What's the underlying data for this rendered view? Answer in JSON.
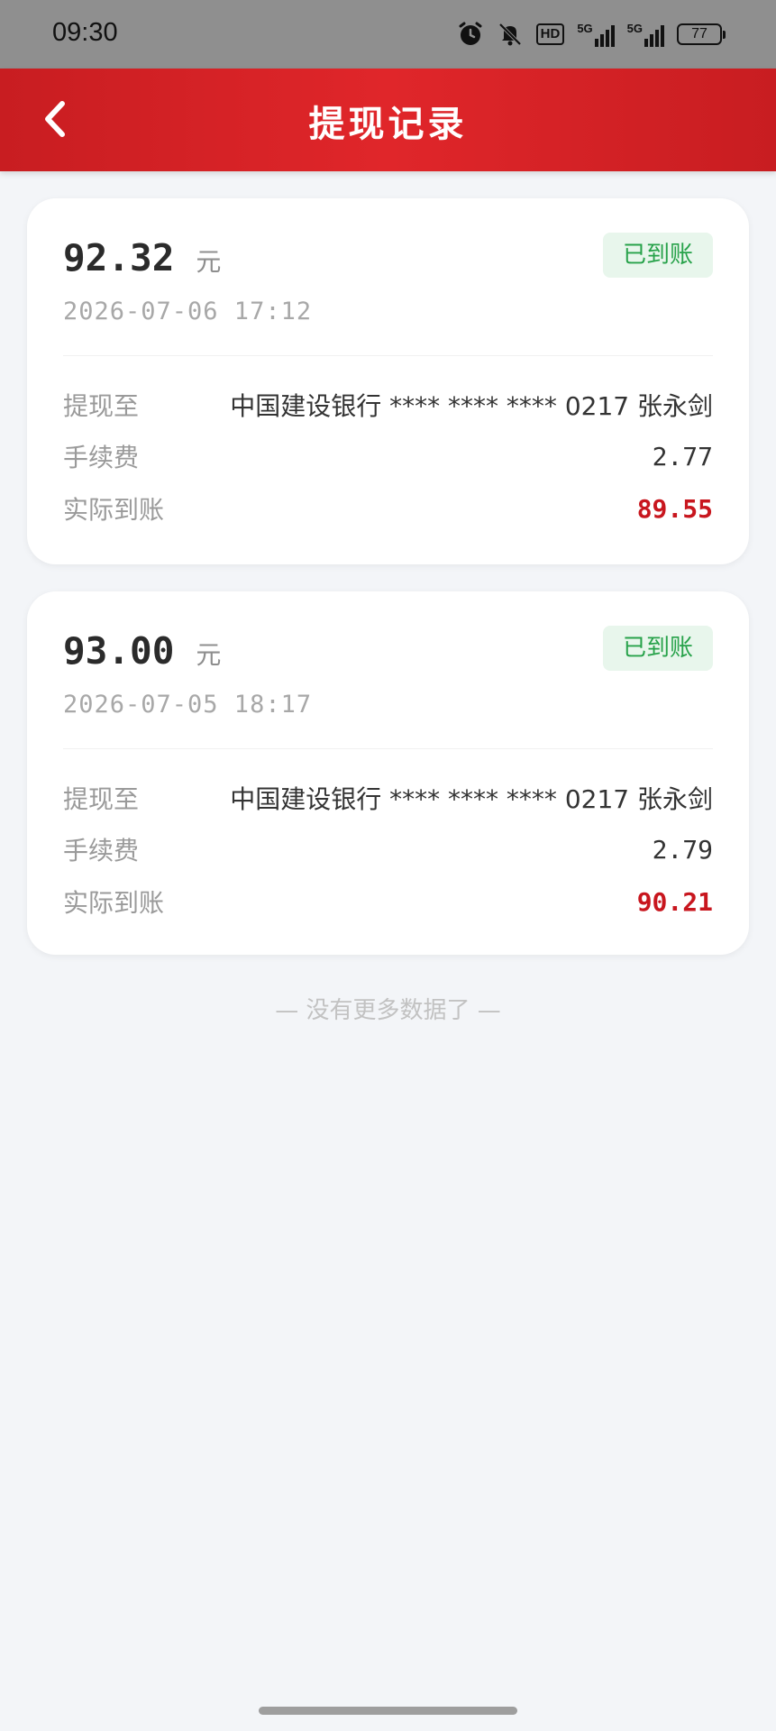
{
  "status_bar": {
    "time": "09:30",
    "hd_label": "HD",
    "network_1": "5G",
    "network_2": "5G",
    "battery": "77"
  },
  "header": {
    "title": "提现记录",
    "back_icon": "chevron-left-icon"
  },
  "records": [
    {
      "amount": "92.32",
      "unit": "元",
      "status": "已到账",
      "time": "2026-07-06 17:12",
      "to_label": "提现至",
      "to_value": "中国建设银行 **** **** **** 0217 张永剑",
      "fee_label": "手续费",
      "fee_value": "2.77",
      "actual_label": "实际到账",
      "actual_value": "89.55"
    },
    {
      "amount": "93.00",
      "unit": "元",
      "status": "已到账",
      "time": "2026-07-05 18:17",
      "to_label": "提现至",
      "to_value": "中国建设银行 **** **** **** 0217 张永剑",
      "fee_label": "手续费",
      "fee_value": "2.79",
      "actual_label": "实际到账",
      "actual_value": "90.21"
    }
  ],
  "footer": {
    "no_more_text": "— 没有更多数据了 —"
  },
  "colors": {
    "header_red": "#d92126",
    "status_green": "#27a24a",
    "highlight_red": "#c8161e",
    "background": "#f3f5f8"
  }
}
